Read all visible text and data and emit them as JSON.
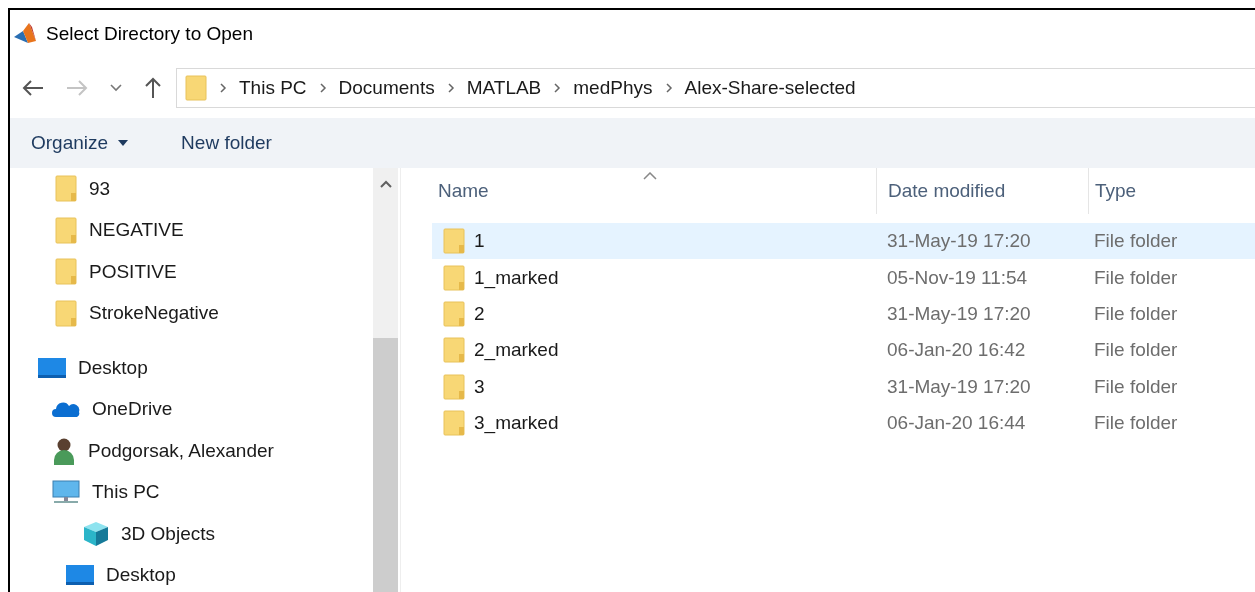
{
  "window": {
    "title": "Select Directory to Open"
  },
  "address_bar": {
    "crumbs": [
      "This PC",
      "Documents",
      "MATLAB",
      "medPhys",
      "Alex-Share-selected"
    ]
  },
  "toolbar": {
    "organize": "Organize",
    "new_folder": "New folder"
  },
  "sidebar": {
    "items": [
      {
        "kind": "folder",
        "label": "93"
      },
      {
        "kind": "folder",
        "label": "NEGATIVE"
      },
      {
        "kind": "folder",
        "label": "POSITIVE"
      },
      {
        "kind": "folder",
        "label": "StrokeNegative"
      },
      {
        "kind": "desktop",
        "label": "Desktop",
        "children": [
          {
            "kind": "cloud",
            "label": "OneDrive"
          },
          {
            "kind": "user",
            "label": "Podgorsak, Alexander"
          },
          {
            "kind": "pc",
            "label": "This PC",
            "children": [
              {
                "kind": "cube",
                "label": "3D Objects"
              },
              {
                "kind": "desktop",
                "label": "Desktop"
              }
            ]
          }
        ]
      }
    ]
  },
  "table": {
    "columns": [
      "Name",
      "Date modified",
      "Type"
    ],
    "rows": [
      {
        "name": "1",
        "date": "31-May-19 17:20",
        "type": "File folder",
        "selected": true
      },
      {
        "name": "1_marked",
        "date": "05-Nov-19 11:54",
        "type": "File folder",
        "selected": false
      },
      {
        "name": "2",
        "date": "31-May-19 17:20",
        "type": "File folder",
        "selected": false
      },
      {
        "name": "2_marked",
        "date": "06-Jan-20 16:42",
        "type": "File folder",
        "selected": false
      },
      {
        "name": "3",
        "date": "31-May-19 17:20",
        "type": "File folder",
        "selected": false
      },
      {
        "name": "3_marked",
        "date": "06-Jan-20 16:44",
        "type": "File folder",
        "selected": false
      }
    ]
  }
}
